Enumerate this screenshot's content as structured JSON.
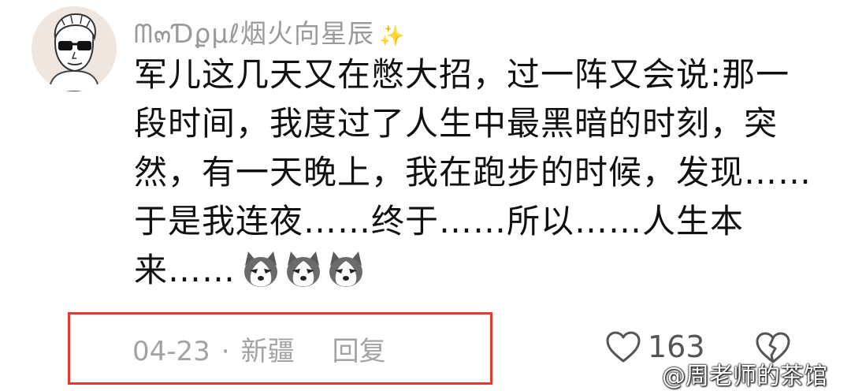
{
  "comment": {
    "username": "ᗰ๓Ɗϼμℓ烟火向星辰",
    "text": "军儿这几天又在憋大招，过一阵又会说:那一段时间，我度过了人生中最黑暗的时刻，突然，有一天晚上，我在跑步的时候，发现……于是我连夜……终于……所以……人生本来……",
    "emojis": [
      "husky",
      "husky",
      "husky"
    ],
    "date": "04-23",
    "separator": "·",
    "location": "新疆",
    "reply_label": "回复",
    "like_count": "163"
  },
  "watermark": "@周老师的茶馆",
  "colors": {
    "highlight_border": "#e53935",
    "meta_text": "#a3a3a3",
    "avatar_bg": "#efe6df"
  },
  "icons": [
    "avatar-man-sunglasses",
    "sparkle-icon",
    "husky-emoji",
    "heart-icon",
    "broken-heart-icon"
  ]
}
